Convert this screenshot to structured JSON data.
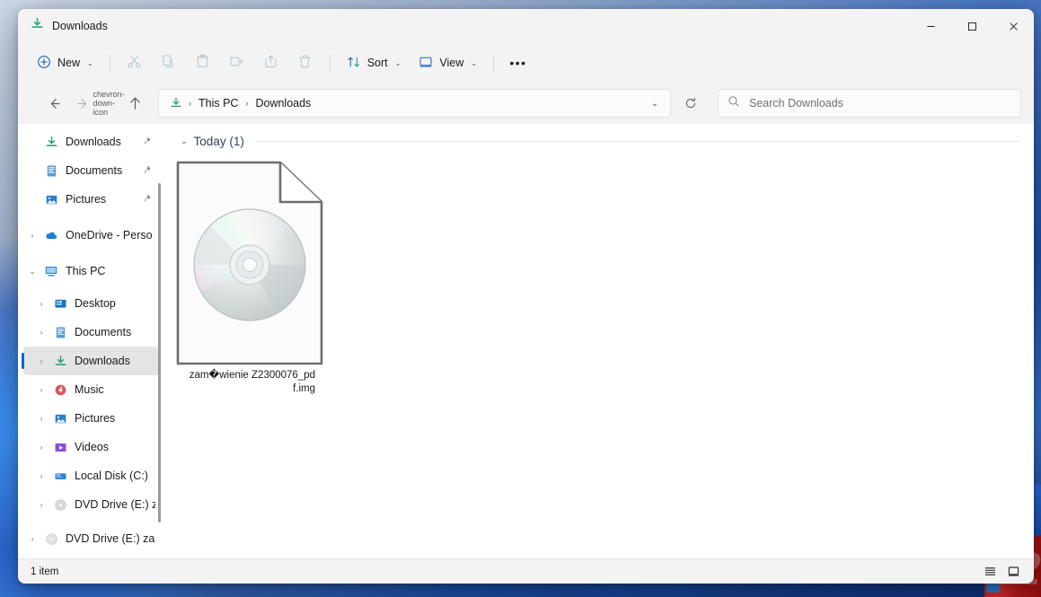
{
  "window": {
    "title": "Downloads",
    "title_icon": "downloads-icon",
    "minimize_label": "—",
    "maximize_label": "□",
    "close_label": "✕"
  },
  "toolbar": {
    "new_label": "New",
    "new_icon": "plus-circle-icon",
    "cut_icon": "scissors-icon",
    "copy_icon": "copy-icon",
    "paste_icon": "clipboard-icon",
    "rename_icon": "rename-icon",
    "share_icon": "share-icon",
    "delete_icon": "trash-icon",
    "sort_label": "Sort",
    "sort_icon": "sort-arrows-icon",
    "view_label": "View",
    "view_icon": "monitor-icon",
    "more_label": "•••",
    "chevron": "⌄"
  },
  "navigation": {
    "back_icon": "arrow-left-icon",
    "forward_icon": "arrow-right-icon",
    "recent_icon": "chevron-down-icon",
    "up_icon": "arrow-up-icon",
    "breadcrumb": {
      "leading_icon": "downloads-icon",
      "separator": "›",
      "items": [
        "This PC",
        "Downloads"
      ]
    },
    "addressbar_chevron": "⌄",
    "refresh_icon": "refresh-icon"
  },
  "search": {
    "icon": "search-icon",
    "placeholder": "Search Downloads",
    "value": ""
  },
  "sidebar": {
    "items": [
      {
        "label": "Downloads",
        "icon": "downloads-icon",
        "indent": 1,
        "expander": "",
        "pinned": true,
        "selected": false
      },
      {
        "label": "Documents",
        "icon": "documents-icon",
        "indent": 1,
        "expander": "",
        "pinned": true,
        "selected": false
      },
      {
        "label": "Pictures",
        "icon": "pictures-icon",
        "indent": 1,
        "expander": "",
        "pinned": true,
        "selected": false
      },
      {
        "label": "OneDrive - Perso",
        "icon": "onedrive-icon",
        "indent": 0,
        "expander": "›",
        "pinned": false,
        "selected": false
      },
      {
        "label": "This PC",
        "icon": "thispc-icon",
        "indent": 0,
        "expander": "⌄",
        "pinned": false,
        "selected": false
      },
      {
        "label": "Desktop",
        "icon": "desktop-icon",
        "indent": 1,
        "expander": "›",
        "pinned": false,
        "selected": false
      },
      {
        "label": "Documents",
        "icon": "documents-icon",
        "indent": 1,
        "expander": "›",
        "pinned": false,
        "selected": false
      },
      {
        "label": "Downloads",
        "icon": "downloads-icon",
        "indent": 1,
        "expander": "›",
        "pinned": false,
        "selected": true
      },
      {
        "label": "Music",
        "icon": "music-icon",
        "indent": 1,
        "expander": "›",
        "pinned": false,
        "selected": false
      },
      {
        "label": "Pictures",
        "icon": "pictures-icon",
        "indent": 1,
        "expander": "›",
        "pinned": false,
        "selected": false
      },
      {
        "label": "Videos",
        "icon": "videos-icon",
        "indent": 1,
        "expander": "›",
        "pinned": false,
        "selected": false
      },
      {
        "label": "Local Disk (C:)",
        "icon": "harddrive-icon",
        "indent": 1,
        "expander": "›",
        "pinned": false,
        "selected": false
      },
      {
        "label": "DVD Drive (E:) z",
        "icon": "disc-icon",
        "indent": 1,
        "expander": "›",
        "pinned": false,
        "selected": false
      },
      {
        "label": "DVD Drive (E:) za",
        "icon": "disc-icon",
        "indent": 0,
        "expander": "›",
        "pinned": false,
        "selected": false
      }
    ],
    "pin_glyph": "📌"
  },
  "content": {
    "group": {
      "chevron": "⌄",
      "label": "Today (1)"
    },
    "files": [
      {
        "name_line1": "zam�wienie Z2300076_pdf",
        "name_line2": ".img",
        "icon": "disc-image-file-icon"
      }
    ]
  },
  "statusbar": {
    "item_count": "1 item",
    "details_view_icon": "list-view-icon",
    "large_icons_view_icon": "large-icons-view-icon"
  },
  "colors": {
    "accent": "#0067c0",
    "window_bg": "#f3f3f3",
    "content_bg": "#ffffff",
    "selection": "#e4e4e4",
    "group_text": "#34405a",
    "downloads_green": "#1f9e6e"
  }
}
